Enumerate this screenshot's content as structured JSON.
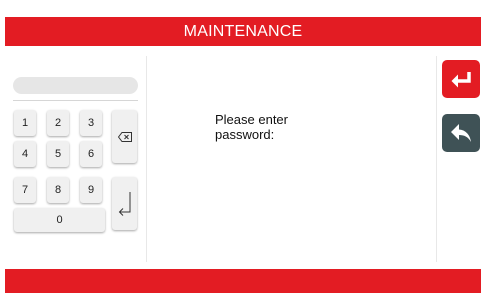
{
  "header": {
    "title": "MAINTENANCE"
  },
  "keypad": {
    "display_value": "",
    "keys": [
      "1",
      "2",
      "3",
      "4",
      "5",
      "6",
      "7",
      "8",
      "9",
      "0"
    ]
  },
  "prompt": {
    "line1": "Please enter",
    "line2": "password:"
  },
  "side_buttons": {
    "confirm_icon": "enter-arrow-icon",
    "back_icon": "reply-arrow-icon"
  },
  "colors": {
    "accent": "#e31c23",
    "back_button": "#3f5256"
  }
}
